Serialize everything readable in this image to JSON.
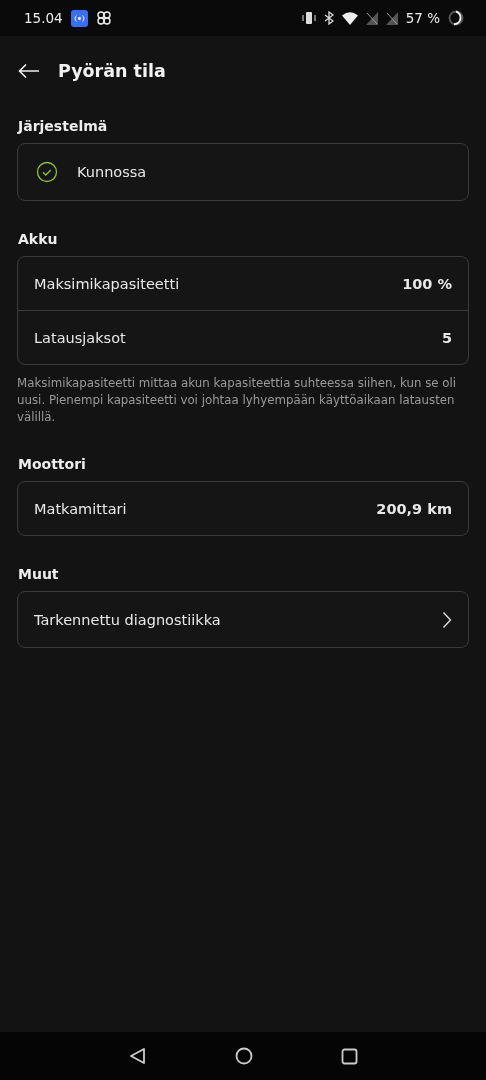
{
  "status_bar": {
    "time": "15.04",
    "battery": "57 %"
  },
  "header": {
    "title": "Pyörän tila"
  },
  "sections": [
    {
      "title": "Järjestelmä",
      "kind": "status",
      "status": "Kunnossa"
    },
    {
      "title": "Akku",
      "kind": "rows",
      "rows": [
        {
          "label": "Maksimikapasiteetti",
          "value": "100 %"
        },
        {
          "label": "Latausjaksot",
          "value": "5"
        }
      ],
      "note": "Maksimikapasiteetti mittaa akun kapasiteettia suhteessa siihen, kun se oli uusi. Pienempi kapasiteetti voi johtaa lyhyempään käyttöaikaan latausten välillä."
    },
    {
      "title": "Moottori",
      "kind": "rows",
      "rows": [
        {
          "label": "Matkamittari",
          "value": "200,9 km"
        }
      ]
    },
    {
      "title": "Muut",
      "kind": "link",
      "label": "Tarkennettu diagnostiikka"
    }
  ]
}
